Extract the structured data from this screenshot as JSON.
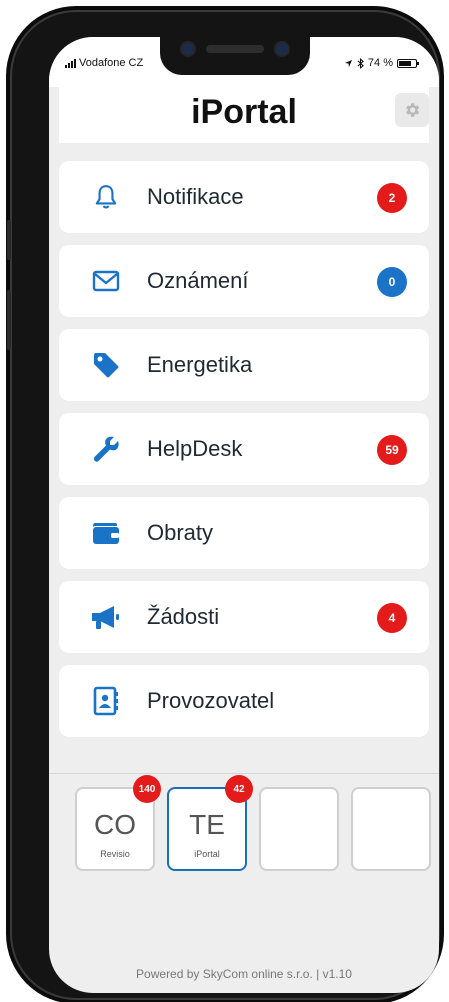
{
  "status_bar": {
    "carrier": "Vodafone CZ",
    "battery_text": "74 %",
    "battery_level": 0.74
  },
  "header": {
    "title": "iPortal",
    "settings_icon": "gear-icon"
  },
  "menu": {
    "items": [
      {
        "label": "Notifikace",
        "icon": "bell-icon",
        "badge": "2",
        "badge_color": "#e31b1b"
      },
      {
        "label": "Oznámení",
        "icon": "envelope-icon",
        "badge": "0",
        "badge_color": "#1a73c7"
      },
      {
        "label": "Energetika",
        "icon": "tag-icon",
        "badge": "",
        "badge_color": ""
      },
      {
        "label": "HelpDesk",
        "icon": "wrench-icon",
        "badge": "59",
        "badge_color": "#e31b1b"
      },
      {
        "label": "Obraty",
        "icon": "wallet-icon",
        "badge": "",
        "badge_color": ""
      },
      {
        "label": "Žádosti",
        "icon": "megaphone-icon",
        "badge": "4",
        "badge_color": "#e31b1b"
      },
      {
        "label": "Provozovatel",
        "icon": "address-book-icon",
        "badge": "",
        "badge_color": ""
      }
    ]
  },
  "tiles": [
    {
      "code": "CO",
      "sub": "Revisio",
      "badge": "140",
      "active": false
    },
    {
      "code": "TE",
      "sub": "iPortal",
      "badge": "42",
      "active": true
    },
    {
      "code": "",
      "sub": "",
      "badge": "",
      "active": false
    },
    {
      "code": "",
      "sub": "",
      "badge": "",
      "active": false
    }
  ],
  "footer": {
    "text": "Powered by SkyCom online s.r.o. | v1.10"
  },
  "colors": {
    "accent": "#1a73c7",
    "badge_red": "#e31b1b",
    "background": "#eeeeee"
  }
}
